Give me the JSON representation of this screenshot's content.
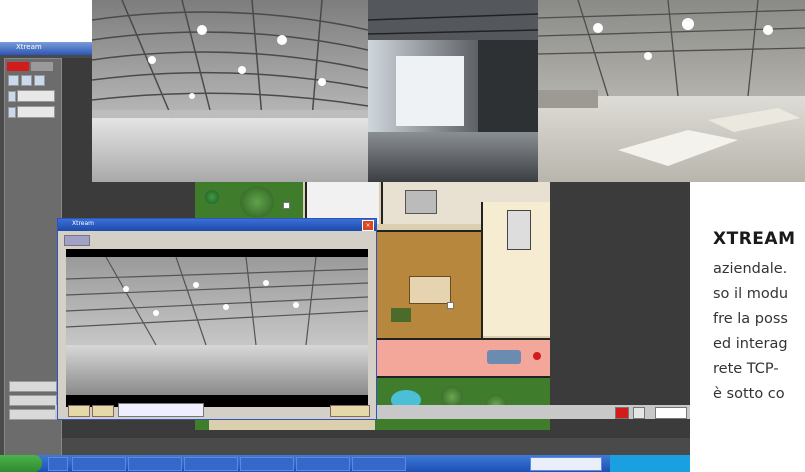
{
  "app": {
    "title": "Xtream",
    "left_panel": {
      "top_buttons": [
        "",
        ""
      ],
      "squares": [
        "",
        "",
        ""
      ],
      "fields": [
        "",
        ""
      ],
      "bottom_buttons": [
        "",
        "",
        ""
      ]
    }
  },
  "popup": {
    "title": "Xtream",
    "buttons_left": [
      "",
      ""
    ],
    "button_right": ""
  },
  "status_bar": {
    "items": [
      "",
      "",
      "",
      "",
      "",
      "",
      "",
      "",
      "",
      "",
      "",
      ""
    ]
  },
  "text_panel": {
    "title": "XTREAM",
    "lines": [
      "aziendale.",
      "so il modu",
      "fre la poss",
      "ed interag",
      "rete TCP-",
      "è sotto co"
    ]
  },
  "colors": {
    "accent_red": "#d21c1c",
    "title_blue": "#2d56b8",
    "taskbar_blue": "#1d4fb4",
    "lawn_green": "#3f7d2c"
  }
}
